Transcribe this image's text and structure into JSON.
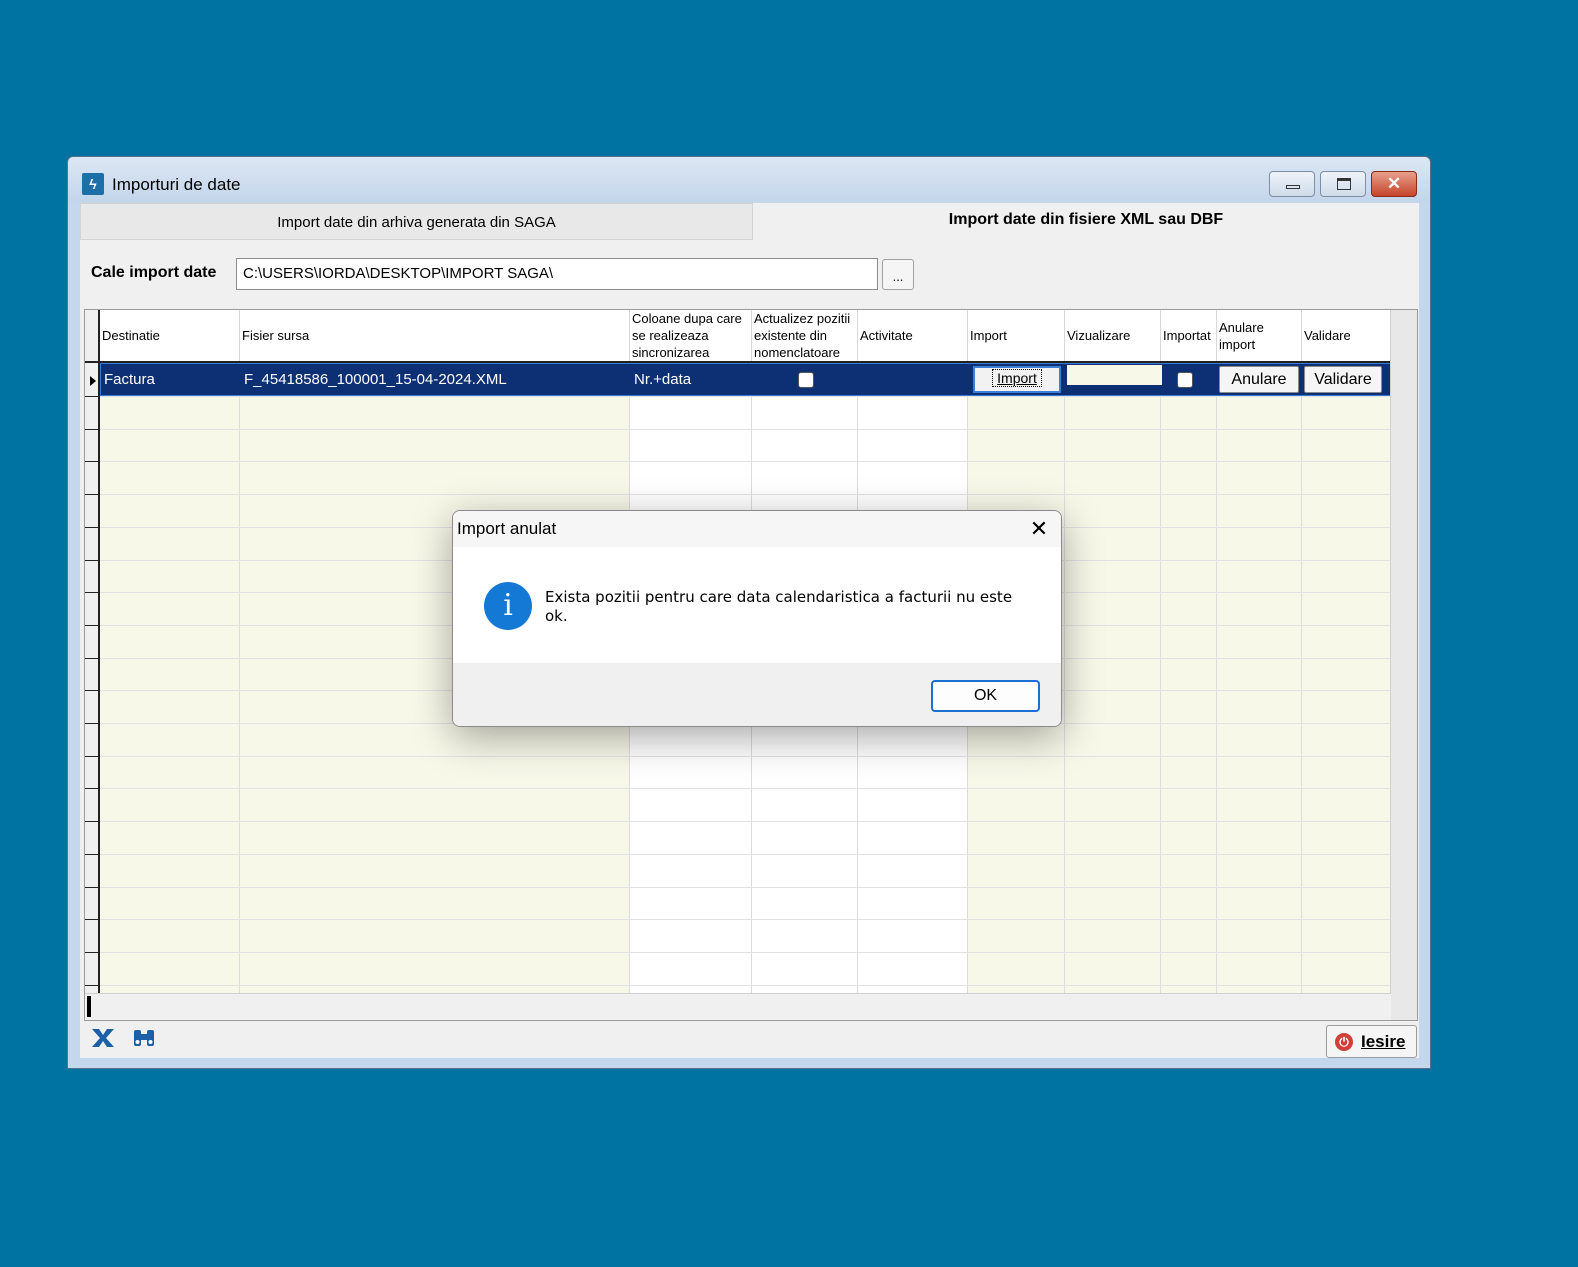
{
  "window": {
    "title": "Importuri de date",
    "icon": "app-lightning-icon"
  },
  "tabs": [
    {
      "label": "Import date din arhiva generata din SAGA",
      "active": false
    },
    {
      "label": "Import date din fisiere XML sau DBF",
      "active": true
    }
  ],
  "path": {
    "label": "Cale import date",
    "value": "C:\\USERS\\IORDA\\DESKTOP\\IMPORT SAGA\\",
    "browse_label": "..."
  },
  "grid": {
    "columns": [
      "Destinatie",
      "Fisier sursa",
      "Coloane dupa care se realizeaza sincronizarea",
      "Actualizez pozitii existente din nomenclatoare",
      "Activitate",
      "Import",
      "Vizualizare",
      "Importat",
      "Anulare import",
      "Validare"
    ],
    "rows": [
      {
        "destinatie": "Factura",
        "fisier": "F_45418586_100001_15-04-2024.XML",
        "coloane": "Nr.+data",
        "actualizez": false,
        "activitate": "",
        "import_label": "Import",
        "importat": false,
        "anulare_label": "Anulare",
        "validare_label": "Validare"
      }
    ]
  },
  "footer": {
    "excel_icon": "excel-export-icon",
    "search_icon": "binoculars-icon",
    "exit_label": "Iesire"
  },
  "dialog": {
    "title": "Import anulat",
    "message": "Exista pozitii pentru care data calendaristica a facturii nu este ok.",
    "ok_label": "OK",
    "icon": "info-icon"
  },
  "colors": {
    "desktop": "#0073a3",
    "selected_row": "#0d2f73",
    "grid_yellow": "#f8f8e9",
    "accent": "#1a6fd1"
  }
}
